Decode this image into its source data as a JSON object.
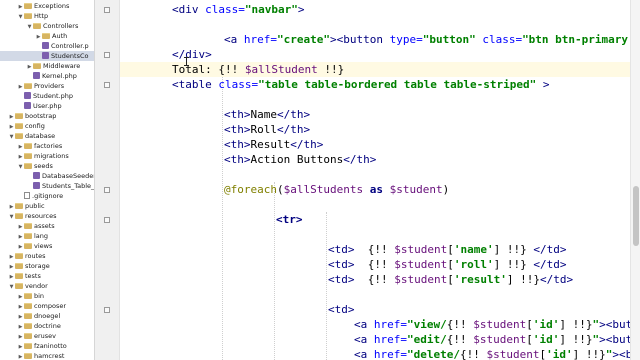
{
  "project_tree": {
    "items": [
      {
        "label": "Exceptions",
        "depth": 1,
        "icon": "folder",
        "expanded": false
      },
      {
        "label": "Http",
        "depth": 1,
        "icon": "folder",
        "expanded": true
      },
      {
        "label": "Controllers",
        "depth": 2,
        "icon": "folder",
        "expanded": true
      },
      {
        "label": "Auth",
        "depth": 3,
        "icon": "folder",
        "expanded": false
      },
      {
        "label": "Controller.p",
        "depth": 3,
        "icon": "php"
      },
      {
        "label": "StudentsCo",
        "depth": 3,
        "icon": "php",
        "selected": true
      },
      {
        "label": "Middleware",
        "depth": 2,
        "icon": "folder",
        "expanded": false
      },
      {
        "label": "Kernel.php",
        "depth": 2,
        "icon": "php"
      },
      {
        "label": "Providers",
        "depth": 1,
        "icon": "folder",
        "expanded": false
      },
      {
        "label": "Student.php",
        "depth": 1,
        "icon": "php"
      },
      {
        "label": "User.php",
        "depth": 1,
        "icon": "php"
      },
      {
        "label": "bootstrap",
        "depth": 0,
        "icon": "folder",
        "expanded": false
      },
      {
        "label": "config",
        "depth": 0,
        "icon": "folder",
        "expanded": false
      },
      {
        "label": "database",
        "depth": 0,
        "icon": "folder",
        "expanded": true
      },
      {
        "label": "factories",
        "depth": 1,
        "icon": "folder",
        "expanded": false
      },
      {
        "label": "migrations",
        "depth": 1,
        "icon": "folder",
        "expanded": false
      },
      {
        "label": "seeds",
        "depth": 1,
        "icon": "folder",
        "expanded": true
      },
      {
        "label": "DatabaseSeeder",
        "depth": 2,
        "icon": "php"
      },
      {
        "label": "Students_Table_",
        "depth": 2,
        "icon": "php"
      },
      {
        "label": ".gitignore",
        "depth": 1,
        "icon": "file"
      },
      {
        "label": "public",
        "depth": 0,
        "icon": "folder",
        "expanded": false
      },
      {
        "label": "resources",
        "depth": 0,
        "icon": "folder",
        "expanded": true
      },
      {
        "label": "assets",
        "depth": 1,
        "icon": "folder",
        "expanded": false
      },
      {
        "label": "lang",
        "depth": 1,
        "icon": "folder",
        "expanded": false
      },
      {
        "label": "views",
        "depth": 1,
        "icon": "folder",
        "expanded": false
      },
      {
        "label": "routes",
        "depth": 0,
        "icon": "folder",
        "expanded": false
      },
      {
        "label": "storage",
        "depth": 0,
        "icon": "folder",
        "expanded": false
      },
      {
        "label": "tests",
        "depth": 0,
        "icon": "folder",
        "expanded": false
      },
      {
        "label": "vendor",
        "depth": 0,
        "icon": "folder",
        "expanded": true
      },
      {
        "label": "bin",
        "depth": 1,
        "icon": "folder",
        "expanded": false
      },
      {
        "label": "composer",
        "depth": 1,
        "icon": "folder",
        "expanded": false
      },
      {
        "label": "dnoegel",
        "depth": 1,
        "icon": "folder",
        "expanded": false
      },
      {
        "label": "doctrine",
        "depth": 1,
        "icon": "folder",
        "expanded": false
      },
      {
        "label": "erusev",
        "depth": 1,
        "icon": "folder",
        "expanded": false
      },
      {
        "label": "fzaninotto",
        "depth": 1,
        "icon": "folder",
        "expanded": false
      },
      {
        "label": "hamcrest",
        "depth": 1,
        "icon": "folder",
        "expanded": false
      }
    ]
  },
  "editor": {
    "current_line": 4,
    "lines": [
      {
        "indent": 52,
        "caret_after": -1,
        "tokens": [
          {
            "t": "<div ",
            "c": "tg"
          },
          {
            "t": "class=",
            "c": "an"
          },
          {
            "t": "\"navbar\"",
            "c": "av"
          },
          {
            "t": ">",
            "c": "tg"
          }
        ]
      },
      {
        "indent": 0,
        "caret_after": -1,
        "tokens": []
      },
      {
        "indent": 104,
        "caret_after": -1,
        "tokens": [
          {
            "t": "<a ",
            "c": "tg"
          },
          {
            "t": "href=",
            "c": "an"
          },
          {
            "t": "\"create\"",
            "c": "av"
          },
          {
            "t": "><button ",
            "c": "tg"
          },
          {
            "t": "type=",
            "c": "an"
          },
          {
            "t": "\"button\"",
            "c": "av"
          },
          {
            "t": " class=",
            "c": "an"
          },
          {
            "t": "\"btn btn-primary b",
            "c": "av"
          }
        ]
      },
      {
        "indent": 52,
        "caret_after": -1,
        "tokens": [
          {
            "t": "</div>",
            "c": "tg"
          }
        ]
      },
      {
        "indent": 52,
        "caret_after": 2,
        "tokens": [
          {
            "t": "Total: {!! ",
            "c": "tx"
          },
          {
            "t": "$allStudent",
            "c": "ev"
          },
          {
            "t": " !!}",
            "c": "tx"
          }
        ]
      },
      {
        "indent": 52,
        "caret_after": -1,
        "tokens": [
          {
            "t": "<table ",
            "c": "tg"
          },
          {
            "t": "class=",
            "c": "an"
          },
          {
            "t": "\"table table-bordered table table-striped\"",
            "c": "av"
          },
          {
            "t": " >",
            "c": "tg"
          }
        ]
      },
      {
        "indent": 0,
        "caret_after": -1,
        "tokens": []
      },
      {
        "indent": 104,
        "caret_after": -1,
        "tokens": [
          {
            "t": "<th>",
            "c": "tg"
          },
          {
            "t": "Name",
            "c": "tx"
          },
          {
            "t": "</th>",
            "c": "tg"
          }
        ]
      },
      {
        "indent": 104,
        "caret_after": -1,
        "tokens": [
          {
            "t": "<th>",
            "c": "tg"
          },
          {
            "t": "Roll",
            "c": "tx"
          },
          {
            "t": "</th>",
            "c": "tg"
          }
        ]
      },
      {
        "indent": 104,
        "caret_after": -1,
        "tokens": [
          {
            "t": "<th>",
            "c": "tg"
          },
          {
            "t": "Result",
            "c": "tx"
          },
          {
            "t": "</th>",
            "c": "tg"
          }
        ]
      },
      {
        "indent": 104,
        "caret_after": -1,
        "tokens": [
          {
            "t": "<th>",
            "c": "tg"
          },
          {
            "t": "Action Buttons",
            "c": "tx"
          },
          {
            "t": "</th>",
            "c": "tg"
          }
        ]
      },
      {
        "indent": 0,
        "caret_after": -1,
        "tokens": []
      },
      {
        "indent": 104,
        "caret_after": -1,
        "tokens": [
          {
            "t": "@foreach",
            "c": "at"
          },
          {
            "t": "(",
            "c": "tx"
          },
          {
            "t": "$allStudents",
            "c": "ev"
          },
          {
            "t": " as ",
            "c": "kw"
          },
          {
            "t": "$student",
            "c": "ev"
          },
          {
            "t": ")",
            "c": "tx"
          }
        ]
      },
      {
        "indent": 0,
        "caret_after": -1,
        "tokens": []
      },
      {
        "indent": 156,
        "caret_after": -1,
        "tokens": [
          {
            "t": "<tr>",
            "c": "tg b"
          }
        ]
      },
      {
        "indent": 0,
        "caret_after": -1,
        "tokens": []
      },
      {
        "indent": 208,
        "caret_after": -1,
        "tokens": [
          {
            "t": "<td>",
            "c": "tg"
          },
          {
            "t": "  {!! ",
            "c": "tx"
          },
          {
            "t": "$student",
            "c": "ev"
          },
          {
            "t": "[",
            "c": "tx"
          },
          {
            "t": "'name'",
            "c": "sn"
          },
          {
            "t": "] !!} ",
            "c": "tx"
          },
          {
            "t": "</td>",
            "c": "tg"
          }
        ]
      },
      {
        "indent": 208,
        "caret_after": -1,
        "tokens": [
          {
            "t": "<td>",
            "c": "tg"
          },
          {
            "t": "  {!! ",
            "c": "tx"
          },
          {
            "t": "$student",
            "c": "ev"
          },
          {
            "t": "[",
            "c": "tx"
          },
          {
            "t": "'roll'",
            "c": "sn"
          },
          {
            "t": "] !!} ",
            "c": "tx"
          },
          {
            "t": "</td>",
            "c": "tg"
          }
        ]
      },
      {
        "indent": 208,
        "caret_after": -1,
        "tokens": [
          {
            "t": "<td>",
            "c": "tg"
          },
          {
            "t": "  {!! ",
            "c": "tx"
          },
          {
            "t": "$student",
            "c": "ev"
          },
          {
            "t": "[",
            "c": "tx"
          },
          {
            "t": "'result'",
            "c": "sn"
          },
          {
            "t": "] !!}",
            "c": "tx"
          },
          {
            "t": "</td>",
            "c": "tg"
          }
        ]
      },
      {
        "indent": 0,
        "caret_after": -1,
        "tokens": []
      },
      {
        "indent": 208,
        "caret_after": -1,
        "tokens": [
          {
            "t": "<td>",
            "c": "tg"
          }
        ]
      },
      {
        "indent": 234,
        "caret_after": -1,
        "tokens": [
          {
            "t": "<a ",
            "c": "tg"
          },
          {
            "t": "href=",
            "c": "an"
          },
          {
            "t": "\"view/",
            "c": "av"
          },
          {
            "t": "{!! ",
            "c": "tx"
          },
          {
            "t": "$student",
            "c": "ev"
          },
          {
            "t": "[",
            "c": "tx"
          },
          {
            "t": "'id'",
            "c": "sn"
          },
          {
            "t": "] !!}",
            "c": "tx"
          },
          {
            "t": "\"",
            "c": "av"
          },
          {
            "t": "><butto",
            "c": "tg"
          }
        ]
      },
      {
        "indent": 234,
        "caret_after": -1,
        "tokens": [
          {
            "t": "<a ",
            "c": "tg"
          },
          {
            "t": "href=",
            "c": "an"
          },
          {
            "t": "\"edit/",
            "c": "av"
          },
          {
            "t": "{!! ",
            "c": "tx"
          },
          {
            "t": "$student",
            "c": "ev"
          },
          {
            "t": "[",
            "c": "tx"
          },
          {
            "t": "'id'",
            "c": "sn"
          },
          {
            "t": "] !!}",
            "c": "tx"
          },
          {
            "t": "\"",
            "c": "av"
          },
          {
            "t": "><butto",
            "c": "tg"
          }
        ]
      },
      {
        "indent": 234,
        "caret_after": -1,
        "tokens": [
          {
            "t": "<a ",
            "c": "tg"
          },
          {
            "t": "href=",
            "c": "an"
          },
          {
            "t": "\"delete/",
            "c": "av"
          },
          {
            "t": "{!! ",
            "c": "tx"
          },
          {
            "t": "$student",
            "c": "ev"
          },
          {
            "t": "[",
            "c": "tx"
          },
          {
            "t": "'id'",
            "c": "sn"
          },
          {
            "t": "] !!}",
            "c": "tx"
          },
          {
            "t": "\"",
            "c": "av"
          },
          {
            "t": "><bu",
            "c": "tg"
          }
        ]
      }
    ]
  }
}
